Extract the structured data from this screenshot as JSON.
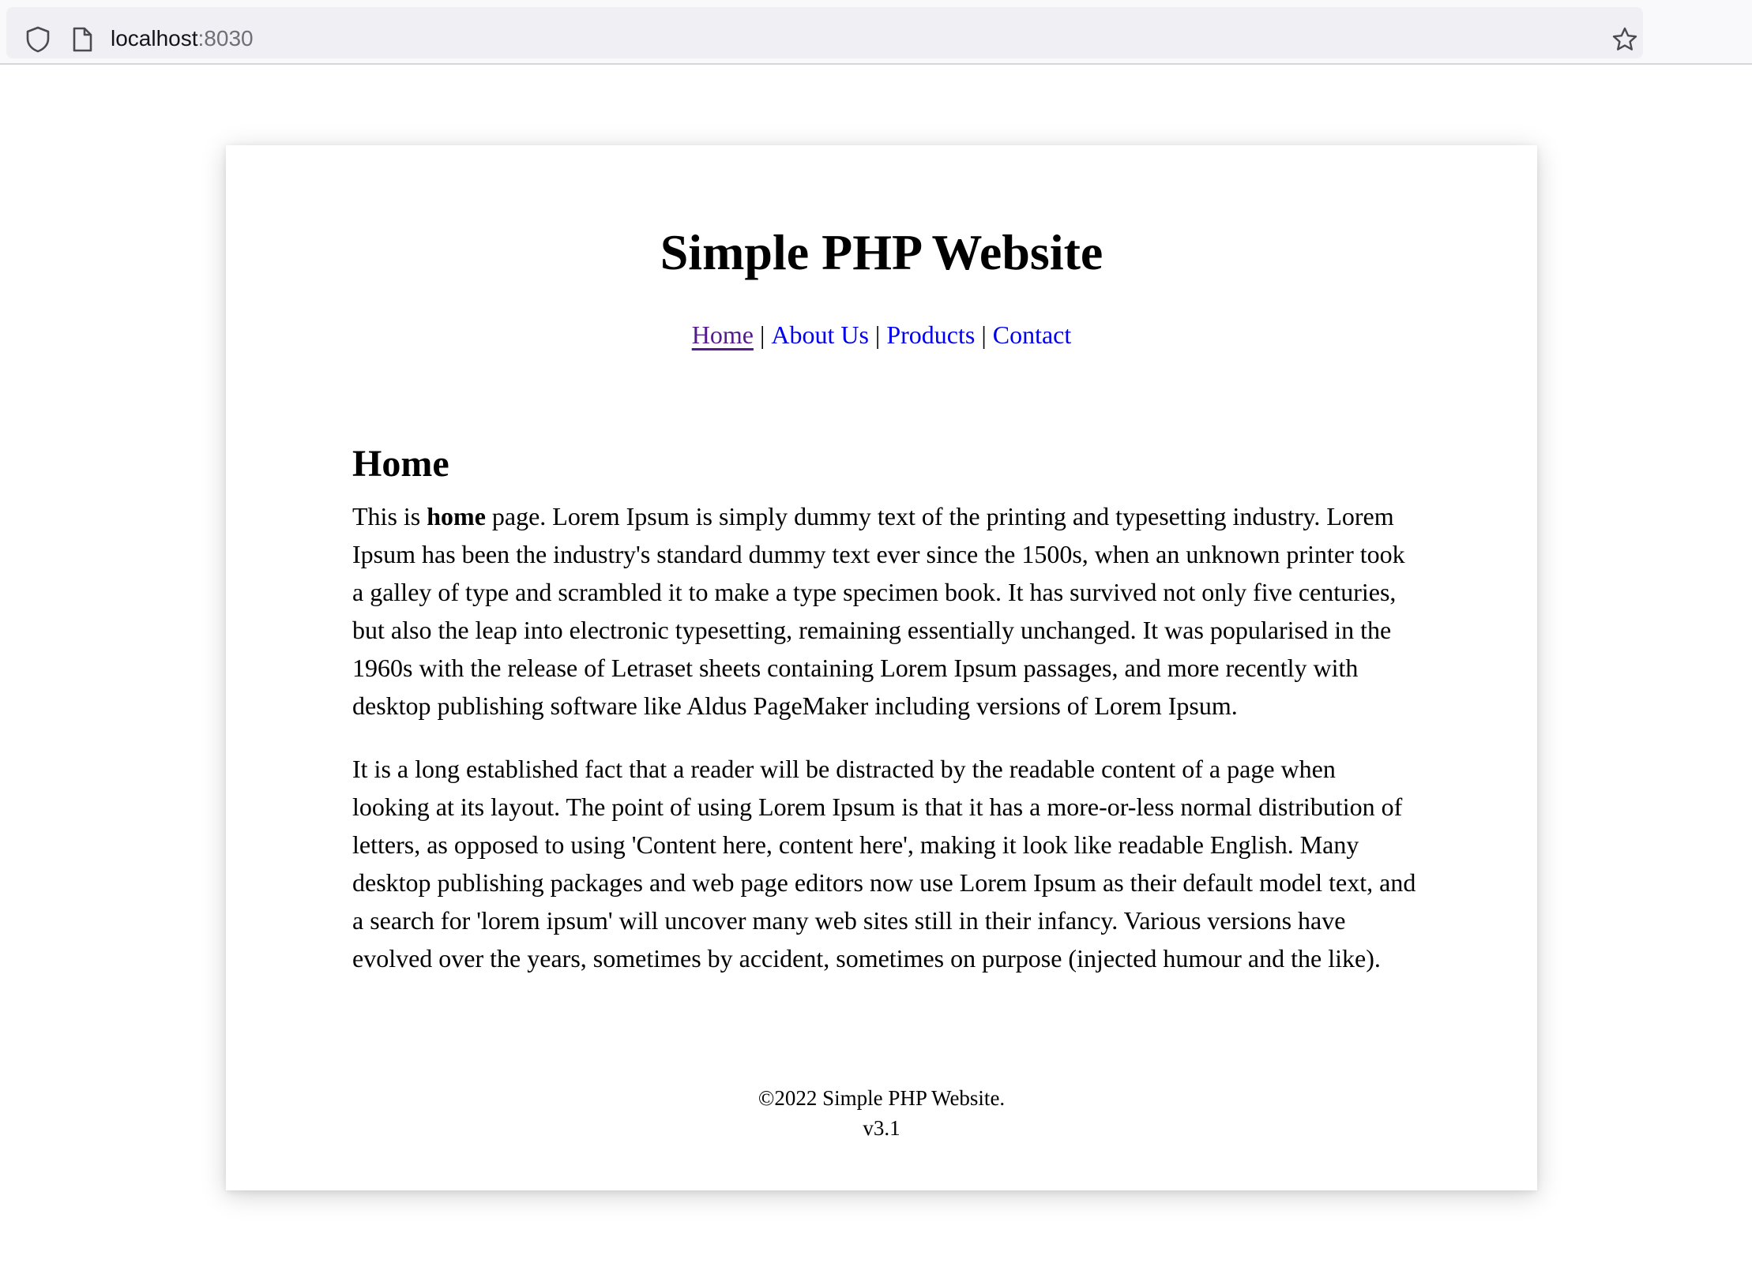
{
  "browser": {
    "url_host": "localhost",
    "url_port": ":8030",
    "icons": [
      "shield-icon",
      "page-icon",
      "star-icon"
    ]
  },
  "site": {
    "title": "Simple PHP Website",
    "nav": [
      {
        "label": "Home",
        "active": true
      },
      {
        "label": "About Us",
        "active": false
      },
      {
        "label": "Products",
        "active": false
      },
      {
        "label": "Contact",
        "active": false
      }
    ],
    "nav_separator": "|"
  },
  "page": {
    "heading": "Home",
    "p1_prefix": "This is ",
    "p1_bold": "home",
    "p1_rest": " page. Lorem Ipsum is simply dummy text of the printing and typesetting industry. Lorem Ipsum has been the industry's standard dummy text ever since the 1500s, when an unknown printer took a galley of type and scrambled it to make a type specimen book. It has survived not only five centuries, but also the leap into electronic typesetting, remaining essentially unchanged. It was popularised in the 1960s with the release of Letraset sheets containing Lorem Ipsum passages, and more recently with desktop publishing software like Aldus PageMaker including versions of Lorem Ipsum.",
    "p2": "It is a long established fact that a reader will be distracted by the readable content of a page when looking at its layout. The point of using Lorem Ipsum is that it has a more-or-less normal distribution of letters, as opposed to using 'Content here, content here', making it look like readable English. Many desktop publishing packages and web page editors now use Lorem Ipsum as their default model text, and a search for 'lorem ipsum' will uncover many web sites still in their infancy. Various versions have evolved over the years, sometimes by accident, sometimes on purpose (injected humour and the like)."
  },
  "footer": {
    "copyright": "©2022 Simple PHP Website.",
    "version": "v3.1"
  },
  "colors": {
    "link": "#0000ee",
    "visited_link": "#551a8b"
  }
}
